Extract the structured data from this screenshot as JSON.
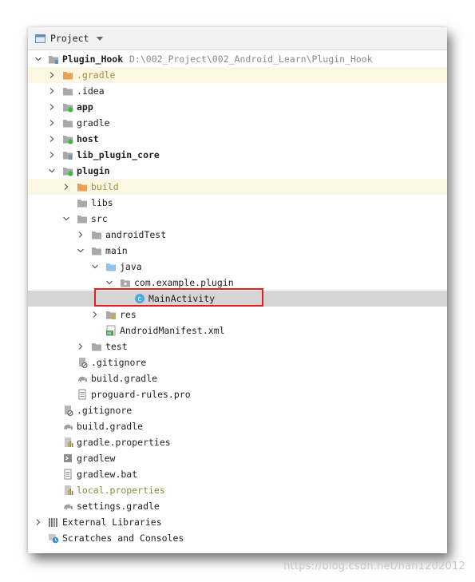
{
  "panel": {
    "title": "Project"
  },
  "tree": {
    "root": {
      "label": "Plugin_Hook",
      "path": "D:\\002_Project\\002_Android_Learn\\Plugin_Hook"
    },
    "gradle_dir": ".gradle",
    "idea_dir": ".idea",
    "app_module": "app",
    "gradle_folder": "gradle",
    "host_module": "host",
    "lib_module": "lib_plugin_core",
    "plugin_module": "plugin",
    "build_dir": "build",
    "libs_dir": "libs",
    "src_dir": "src",
    "androidtest_dir": "androidTest",
    "main_dir": "main",
    "java_dir": "java",
    "package": "com.example.plugin",
    "main_activity": "MainActivity",
    "res_dir": "res",
    "manifest": "AndroidManifest.xml",
    "test_dir": "test",
    "plugin_gitignore": ".gitignore",
    "plugin_build_gradle": "build.gradle",
    "proguard": "proguard-rules.pro",
    "root_gitignore": ".gitignore",
    "root_build_gradle": "build.gradle",
    "gradle_properties": "gradle.properties",
    "gradlew": "gradlew",
    "gradlew_bat": "gradlew.bat",
    "local_properties": "local.properties",
    "settings_gradle": "settings.gradle",
    "external_libraries": "External Libraries",
    "scratches": "Scratches and Consoles"
  },
  "colors": {
    "selection": "#d5d5d5",
    "ignored_bg": "#fcf7e3",
    "highlight_box": "#e0201c",
    "folder_gray": "#a9a9a9",
    "folder_orange": "#e8a257",
    "folder_blue": "#8fc3ea",
    "module_dot": "#3fb93f",
    "class_icon": "#4fa9d8"
  },
  "watermark": "https://blog.csdn.net/han1202012"
}
